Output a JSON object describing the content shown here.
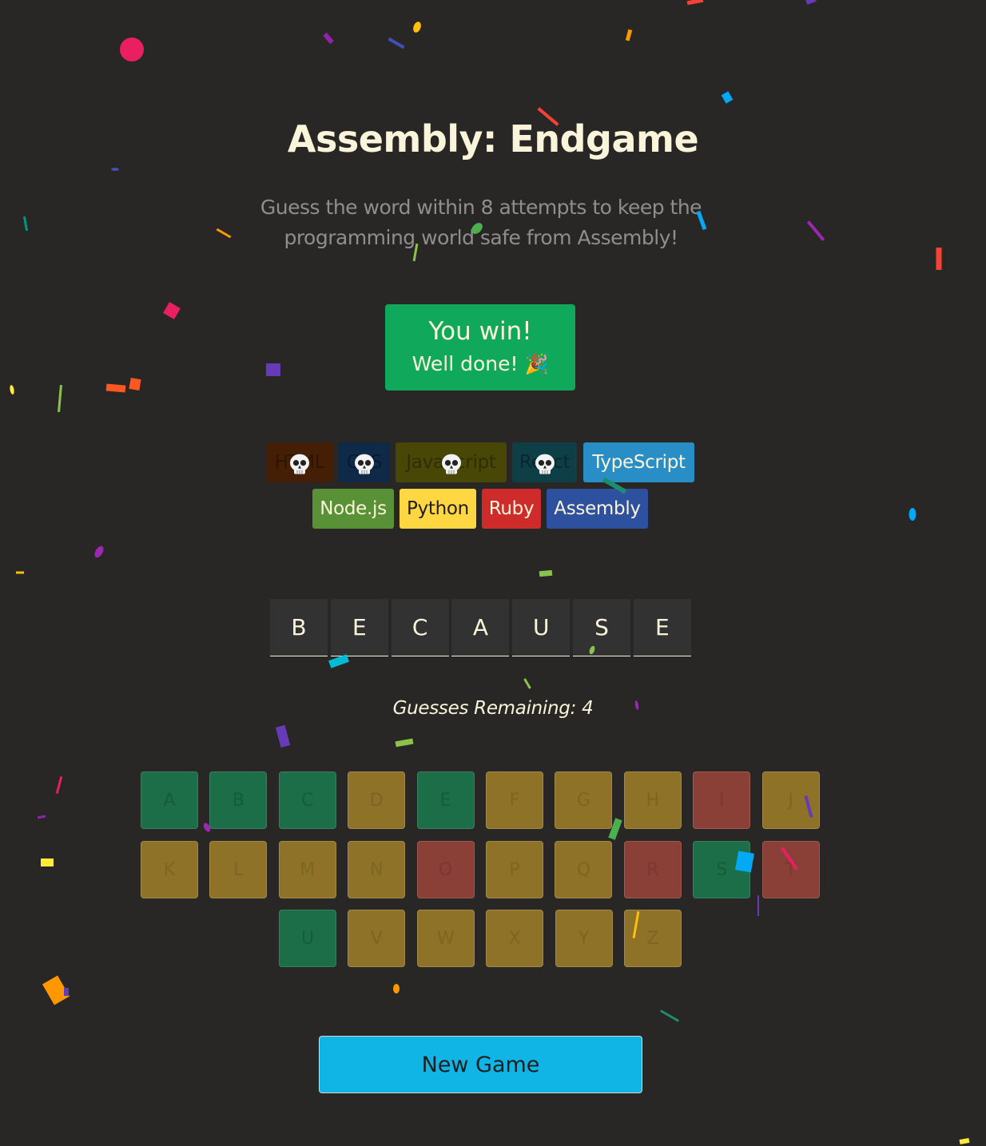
{
  "header": {
    "title": "Assembly: Endgame",
    "subtitle": "Guess the word within 8 attempts to keep the programming world safe from Assembly!"
  },
  "status": {
    "title": "You win!",
    "message": "Well done!",
    "emoji": "🎉",
    "color": "#10A95B"
  },
  "languages": [
    {
      "name": "HTML",
      "bg": "#E2680F",
      "fg": "#F9F4DA",
      "lost": true
    },
    {
      "name": "CSS",
      "bg": "#328AF1",
      "fg": "#F9F4DA",
      "lost": true
    },
    {
      "name": "JavaScript",
      "bg": "#F4EB13",
      "fg": "#1E1E1E",
      "lost": true
    },
    {
      "name": "React",
      "bg": "#2ED3E9",
      "fg": "#1E1E1E",
      "lost": true
    },
    {
      "name": "TypeScript",
      "bg": "#298EC6",
      "fg": "#F9F4DA",
      "lost": false
    },
    {
      "name": "Node.js",
      "bg": "#599137",
      "fg": "#F9F4DA",
      "lost": false
    },
    {
      "name": "Python",
      "bg": "#FFD742",
      "fg": "#1E1E1E",
      "lost": false
    },
    {
      "name": "Ruby",
      "bg": "#D02B2B",
      "fg": "#F9F4DA",
      "lost": false
    },
    {
      "name": "Assembly",
      "bg": "#2D519F",
      "fg": "#F9F4DA",
      "lost": false
    }
  ],
  "lost_icon": "skull-icon",
  "word": [
    "B",
    "E",
    "C",
    "A",
    "U",
    "S",
    "E"
  ],
  "guesses_remaining_label": "Guesses Remaining: 4",
  "keyboard": [
    {
      "letter": "A",
      "state": "correct"
    },
    {
      "letter": "B",
      "state": "correct"
    },
    {
      "letter": "C",
      "state": "correct"
    },
    {
      "letter": "D",
      "state": "unused"
    },
    {
      "letter": "E",
      "state": "correct"
    },
    {
      "letter": "F",
      "state": "unused"
    },
    {
      "letter": "G",
      "state": "unused"
    },
    {
      "letter": "H",
      "state": "unused"
    },
    {
      "letter": "I",
      "state": "wrong"
    },
    {
      "letter": "J",
      "state": "unused"
    },
    {
      "letter": "K",
      "state": "unused"
    },
    {
      "letter": "L",
      "state": "unused"
    },
    {
      "letter": "M",
      "state": "unused"
    },
    {
      "letter": "N",
      "state": "unused"
    },
    {
      "letter": "O",
      "state": "wrong"
    },
    {
      "letter": "P",
      "state": "unused"
    },
    {
      "letter": "Q",
      "state": "unused"
    },
    {
      "letter": "R",
      "state": "wrong"
    },
    {
      "letter": "S",
      "state": "correct"
    },
    {
      "letter": "T",
      "state": "wrong"
    },
    {
      "letter": "U",
      "state": "correct"
    },
    {
      "letter": "V",
      "state": "unused"
    },
    {
      "letter": "W",
      "state": "unused"
    },
    {
      "letter": "X",
      "state": "unused"
    },
    {
      "letter": "Y",
      "state": "unused"
    },
    {
      "letter": "Z",
      "state": "unused"
    }
  ],
  "new_game_label": "New Game",
  "colors": {
    "background": "#282726",
    "title": "#F9F4DA",
    "correct_key": "#1C6E48",
    "wrong_key": "#8A4036",
    "unused_key": "#8D7227",
    "new_game_button": "#11B5E5"
  }
}
